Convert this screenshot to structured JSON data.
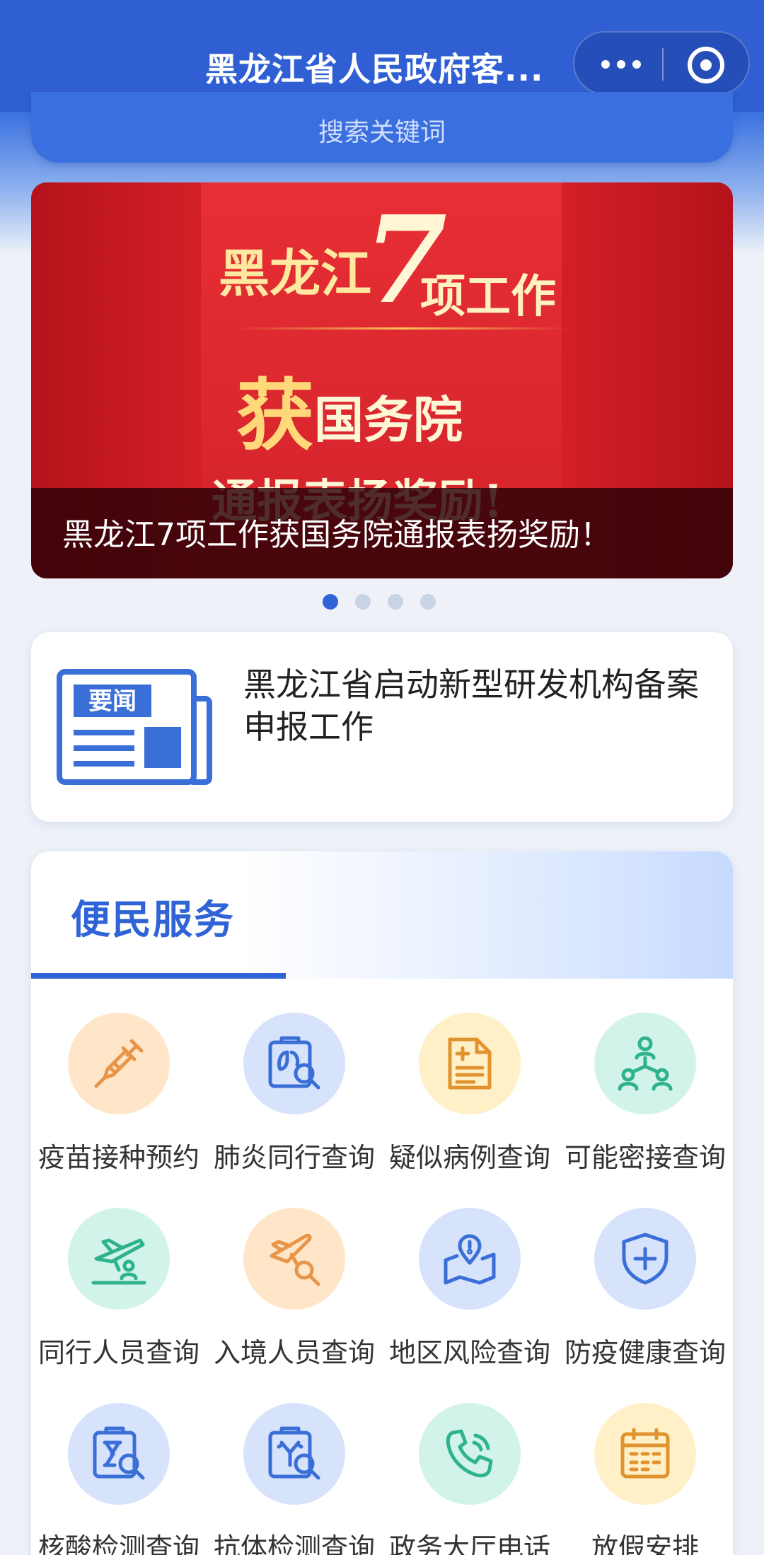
{
  "nav": {
    "title": "黑龙江省人民政府客..."
  },
  "search": {
    "placeholder": "搜索关键词"
  },
  "banner": {
    "line1": "黑龙江",
    "seven": "7",
    "line2": "项工作",
    "char": "获",
    "line3": "国务院",
    "line4": "通报表扬奖励!",
    "caption": "黑龙江7项工作获国务院通报表扬奖励！",
    "dots": 4,
    "active_dot": 1
  },
  "news": {
    "icon_label": "要闻",
    "text": "黑龙江省启动新型研发机构备案申报工作"
  },
  "services": {
    "title": "便民服务",
    "items": [
      {
        "label": "疫苗接种预约",
        "icon": "syringe-icon",
        "color": "#e8954a"
      },
      {
        "label": "肺炎同行查询",
        "icon": "lung-search-icon",
        "color": "#3b6fd8"
      },
      {
        "label": "疑似病例查询",
        "icon": "document-plus-icon",
        "color": "#e0932e"
      },
      {
        "label": "可能密接查询",
        "icon": "people-network-icon",
        "color": "#2fb38d"
      },
      {
        "label": "同行人员查询",
        "icon": "plane-people-icon",
        "color": "#2fb38d"
      },
      {
        "label": "入境人员查询",
        "icon": "plane-search-icon",
        "color": "#e8954a"
      },
      {
        "label": "地区风险查询",
        "icon": "map-alert-icon",
        "color": "#3b6fd8"
      },
      {
        "label": "防疫健康查询",
        "icon": "shield-plus-icon",
        "color": "#3b6fd8"
      },
      {
        "label": "核酸检测查询",
        "icon": "test-tube-search-icon",
        "color": "#3b6fd8"
      },
      {
        "label": "抗体检测查询",
        "icon": "antibody-search-icon",
        "color": "#3b6fd8"
      },
      {
        "label": "政务大厅电话",
        "icon": "phone-icon",
        "color": "#2fb38d"
      },
      {
        "label": "放假安排",
        "icon": "calendar-icon",
        "color": "#e0932e"
      }
    ]
  }
}
